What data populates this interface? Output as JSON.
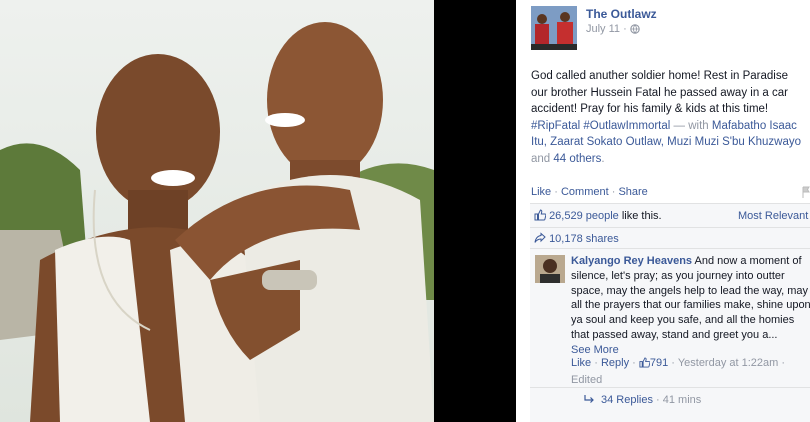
{
  "post": {
    "page_name": "The Outlawz",
    "date": "July 11 ·",
    "body_lines": [
      "God called anuther soldier home! Rest in Paradise",
      "our brother Hussein Fatal he passed away in a car",
      "accident! Pray for his family & kids at this time!"
    ],
    "hashtags": "#RipFatal #OutlawImmortal",
    "with_prefix": " — with ",
    "tag_1": "Mafabatho Isaac",
    "tag_line_2": "Itu, Zaarat Sokato Outlaw, Muzi Muzi S'bu Khuzwayo",
    "and_text": "and ",
    "others": "44 others",
    "period": "."
  },
  "actions": {
    "like": "Like",
    "comment": "Comment",
    "share": "Share",
    "dot": " · "
  },
  "stats": {
    "likes_count": "26,529 people",
    "likes_suffix": " like this.",
    "sort_label": "Most Relevant",
    "shares": "10,178 shares"
  },
  "comment": {
    "author": "Kalyango Rey Heavens",
    "text_first": " And now a moment of",
    "text_lines": [
      "silence, let's pray; as you journey into outter",
      "space, may the angels help to lead the way, may",
      "all the prayers that our families make, shine upon",
      "ya soul and keep you safe, and all the homies",
      "that passed away, stand and greet you a..."
    ],
    "see_more": "See More",
    "like": "Like",
    "reply": "Reply",
    "like_count": "791",
    "time": "Yesterday at 1:22am",
    "edited": "Edited",
    "replies": "34 Replies",
    "replies_time": "41 mins"
  },
  "colors": {
    "link": "#3b5998",
    "muted": "#9197a3",
    "panel_bg": "#f6f7f9"
  }
}
